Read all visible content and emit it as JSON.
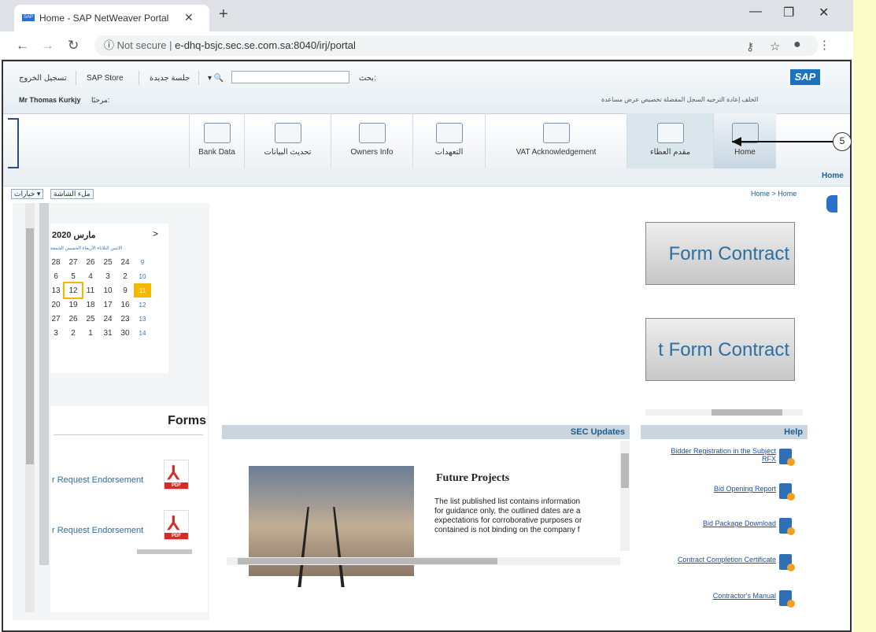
{
  "browser": {
    "tab_title": "Home - SAP NetWeaver Portal",
    "url_prefix": "Not secure",
    "url": "e-dhq-bsjc.sec.se.com.sa:8040/irj/portal"
  },
  "toolbar": {
    "logout": "تسجيل الخروج",
    "sap_store": "SAP Store",
    "new_session": "جلسة جديدة",
    "search_label": "بحث:",
    "welcome_user": "Mr Thomas Kurkjy",
    "welcome_prefix": "مرحبًا:",
    "history_links": "الخلف  إعادة الترجيه  السجل  المفضلة  تخصيص  عرض  مساعدة"
  },
  "nav_tabs": [
    {
      "label": "Bank Data"
    },
    {
      "label": "تحديث البيانات"
    },
    {
      "label": "Owners Info"
    },
    {
      "label": "التعهدات"
    },
    {
      "label": "VAT Acknowledgement"
    },
    {
      "label": "مقدم العطاء"
    },
    {
      "label": "Home"
    }
  ],
  "subnav": {
    "home": "Home"
  },
  "path": {
    "breadcrumb": "Home  >  Home",
    "pane_options": "خيارات ▾",
    "pane_full": "ملء الشاشة"
  },
  "annotation": {
    "number": "5"
  },
  "calendar": {
    "month": "مارس 2020",
    "next": ">",
    "days_header": "الاثنين الثلاثاء الأربعاء الخميس الجمعة",
    "rows": [
      {
        "days": [
          "28",
          "27",
          "26",
          "25",
          "24"
        ],
        "week": "9"
      },
      {
        "days": [
          "6",
          "5",
          "4",
          "3",
          "2"
        ],
        "week": "10"
      },
      {
        "days": [
          "13",
          "12",
          "11",
          "10",
          "9"
        ],
        "week": "11"
      },
      {
        "days": [
          "20",
          "19",
          "18",
          "17",
          "16"
        ],
        "week": "12"
      },
      {
        "days": [
          "27",
          "26",
          "25",
          "24",
          "23"
        ],
        "week": "13"
      },
      {
        "days": [
          "3",
          "2",
          "1",
          "31",
          "30"
        ],
        "week": "14"
      }
    ]
  },
  "forms": {
    "title": "Forms",
    "items": [
      "r Request Endorsement",
      "r Request Endorsement"
    ],
    "pdf_badge": "PDF"
  },
  "contracts": {
    "btn1": "Form Contract",
    "btn2": "t Form Contract"
  },
  "updates": {
    "title": "SEC Updates",
    "heading": "Future Projects",
    "lines": [
      "The list published list contains information",
      "for guidance only, the outlined dates are a",
      "expectations for corroborative purposes or",
      "contained is not binding on the company f"
    ]
  },
  "help": {
    "title": "Help",
    "links": [
      "Bidder Registration in the Subject RFX",
      "Bid Opening Report",
      "Bid Package Download",
      "Contract Completion Certificate",
      "Contractor's Manual"
    ]
  },
  "colors": {
    "accent": "#1b73c0",
    "highlight": "#f5b800",
    "link": "#1a4fb8"
  }
}
